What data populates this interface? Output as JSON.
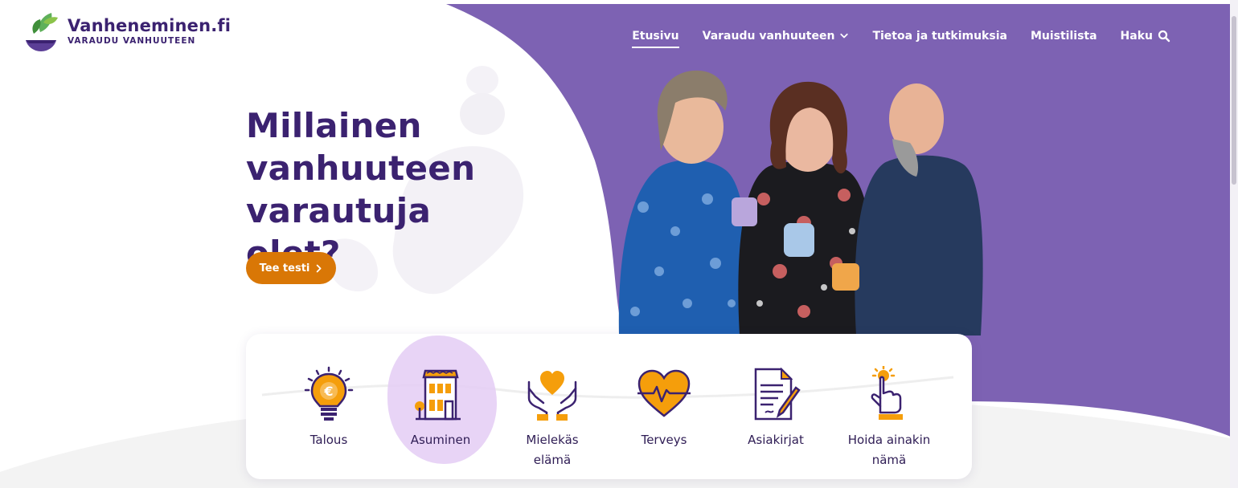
{
  "brand": {
    "title": "Vanheneminen.fi",
    "subtitle": "VARAUDU VANHUUTEEN"
  },
  "nav": {
    "items": [
      {
        "label": "Etusivu",
        "active": true
      },
      {
        "label": "Varaudu vanhuuteen",
        "icon": "chevron-down-icon"
      },
      {
        "label": "Tietoa ja tutkimuksia"
      },
      {
        "label": "Muistilista"
      },
      {
        "label": "Haku",
        "icon": "search-icon"
      }
    ]
  },
  "hero": {
    "title": "Millainen vanhuuteen varautuja olet?",
    "cta_label": "Tee testi",
    "cta_icon": "chevron-right-icon"
  },
  "categories": [
    {
      "label": "Talous",
      "icon": "lightbulb-euro-icon"
    },
    {
      "label": "Asuminen",
      "icon": "building-icon",
      "highlighted": true
    },
    {
      "label": "Mielekäs\nelämä",
      "icon": "hands-heart-icon"
    },
    {
      "label": "Terveys",
      "icon": "heart-pulse-icon"
    },
    {
      "label": "Asiakirjat",
      "icon": "document-pen-icon"
    },
    {
      "label": "Hoida ainakin\nnämä",
      "icon": "hand-pointer-icon"
    }
  ],
  "colors": {
    "purple": "#7d62b3",
    "dark_purple": "#3b2270",
    "orange": "#d97706",
    "icon_orange": "#f59e0b",
    "highlight": "#e4cdf5"
  }
}
